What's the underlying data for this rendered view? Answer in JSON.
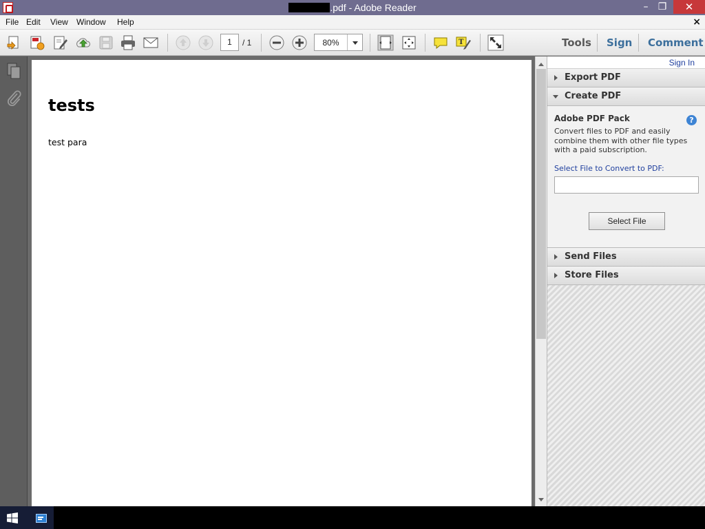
{
  "window": {
    "title_suffix": ".pdf - Adobe Reader",
    "minimize": "–",
    "restore": "❐",
    "close": "✕"
  },
  "menu": {
    "file": "File",
    "edit": "Edit",
    "view": "View",
    "window": "Window",
    "help": "Help",
    "doc_close": "×"
  },
  "toolbar": {
    "page_current": "1",
    "page_total": "/ 1",
    "zoom": "80%",
    "tools": "Tools",
    "sign": "Sign",
    "comment": "Comment"
  },
  "document": {
    "heading": "tests",
    "paragraph": "test para"
  },
  "right_pane": {
    "sign_in": "Sign In",
    "export_pdf": "Export PDF",
    "create_pdf": "Create PDF",
    "pack_title": "Adobe PDF Pack",
    "pack_description": "Convert files to PDF and easily combine them with other file types with a paid subscription.",
    "select_label": "Select File to Convert to PDF:",
    "help_glyph": "?",
    "select_file_button": "Select File",
    "send_files": "Send Files",
    "store_files": "Store Files"
  }
}
